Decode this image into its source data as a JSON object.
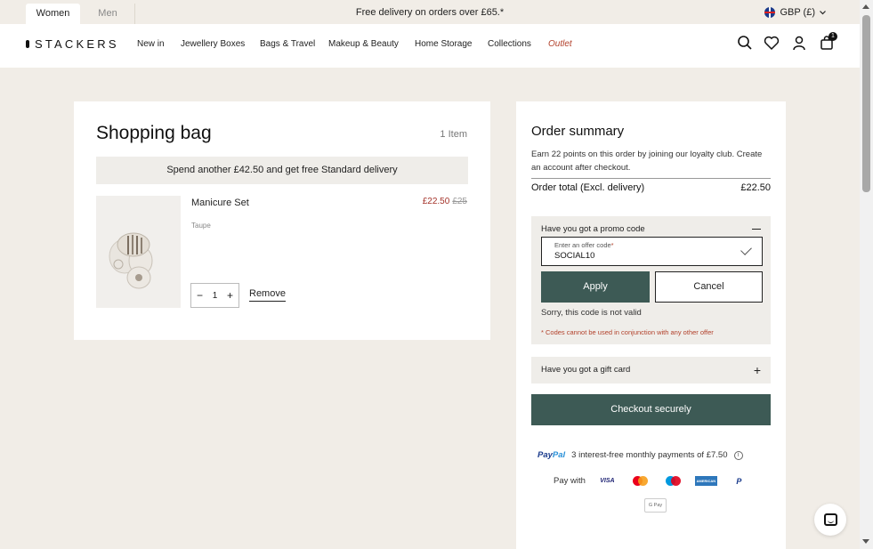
{
  "header": {
    "tabs": [
      "Women",
      "Men"
    ],
    "announcement": "Free delivery on orders over £65.*",
    "currency": "GBP (£)"
  },
  "nav": {
    "logo": "STACKERS",
    "items": [
      "New in",
      "Jewellery Boxes",
      "Bags & Travel",
      "Makeup & Beauty",
      "Home Storage",
      "Collections",
      "Outlet"
    ],
    "bag_count": "1",
    "icons": [
      "search-icon",
      "heart-icon",
      "user-icon",
      "bag-icon"
    ]
  },
  "bag": {
    "title": "Shopping bag",
    "item_count": "1 Item",
    "delivery_banner": "Spend another £42.50 and get free Standard delivery",
    "product": {
      "name": "Manicure Set",
      "price": "£22.50",
      "old_price": "£25",
      "variant": "Taupe",
      "quantity": "1",
      "remove_label": "Remove"
    }
  },
  "summary": {
    "title": "Order summary",
    "loyalty_text": "Earn 22 points on this order by joining our loyalty club. Create an account after checkout.",
    "total_label": "Order total (Excl. delivery)",
    "total_value": "£22.50",
    "promo": {
      "header": "Have you got a promo code",
      "input_label": "Enter an offer code",
      "input_value": "SOCIAL10",
      "apply_label": "Apply",
      "cancel_label": "Cancel",
      "error": "Sorry, this code is not valid",
      "note": "* Codes cannot be used in conjunction with any other offer"
    },
    "gift_card": "Have you got a gift card",
    "checkout_label": "Checkout securely",
    "paypal_text": "3 interest-free monthly payments of £7.50",
    "pay_with": "Pay with"
  },
  "colors": {
    "background": "#f1ede7",
    "accent_green": "#3d5a55",
    "sale_red": "#a4332a"
  }
}
